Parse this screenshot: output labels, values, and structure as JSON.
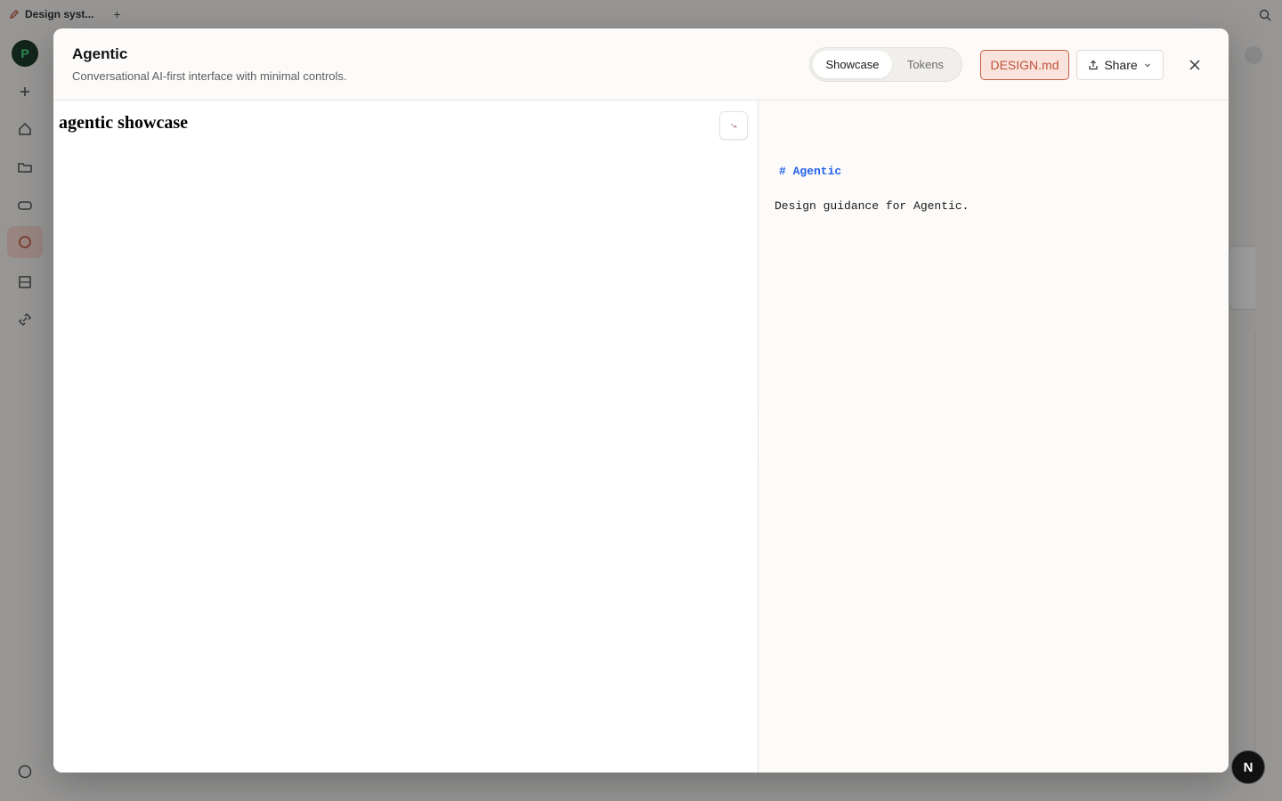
{
  "background": {
    "tab_label": "Design syst...",
    "plus_glyph": "+",
    "logo_letter": "P"
  },
  "modal": {
    "title": "Agentic",
    "subtitle": "Conversational AI-first interface with minimal controls.",
    "tabs": [
      {
        "label": "Showcase",
        "active": true
      },
      {
        "label": "Tokens",
        "active": false
      }
    ],
    "design_button": "DESIGN.md",
    "share_button": "Share",
    "showcase": {
      "heading": "agentic showcase"
    },
    "markdown": {
      "heading": "# Agentic",
      "body": "Design guidance for Agentic."
    },
    "collapse_glyph": "›"
  },
  "badge": {
    "label": "N"
  },
  "colors": {
    "accent": "#c0533b",
    "accent_bg": "#f9e3dc",
    "link_blue": "#2563eb"
  }
}
